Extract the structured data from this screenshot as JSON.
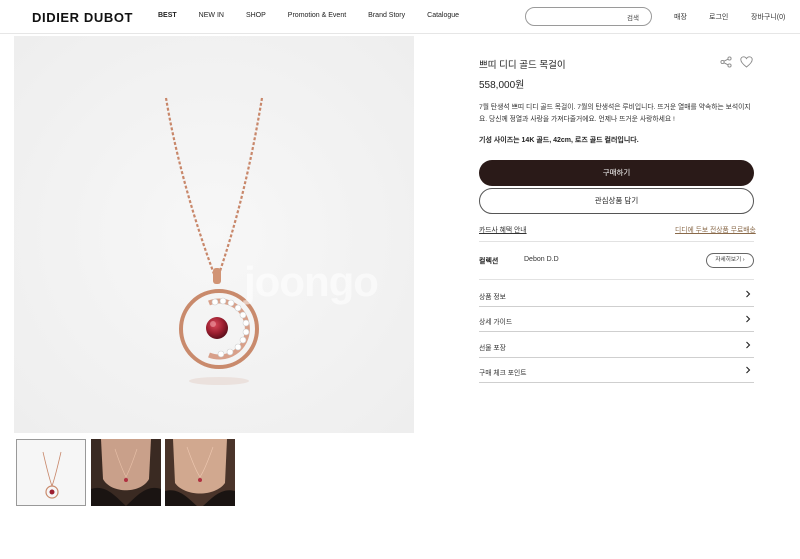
{
  "header": {
    "logo": "DIDIER DUBOT",
    "nav": [
      "BEST",
      "NEW IN",
      "SHOP",
      "Promotion & Event",
      "Brand Story",
      "Catalogue"
    ],
    "search_button": "검색",
    "store": "매장",
    "login": "로그인",
    "cart": "장바구니(0)"
  },
  "watermark": "joongo",
  "product": {
    "title": "쁘띠 디디 골드 목걸이",
    "price": "558,000원",
    "description": "7월 탄생석 쁘띠 디디 골드 목걸이. 7월의 탄생석은 루비입니다. 뜨거운 열매를 약속하는 보석이지요. 당신께 정열과 사랑을 가져다줄거에요. 언제나 뜨거운 사랑하세요 !",
    "spec": "기성 사이즈는 14K 골드, 42cm, 로즈 골드 컬러입니다.",
    "buy_label": "구매하기",
    "wish_label": "관심상품 담기",
    "card_benefit": "카드사 혜택 안내",
    "shipping": "디디에 두보 전상품 무료배송",
    "collection_label": "컬렉션",
    "collection_value": "Debon D.D",
    "detail_button": "자세히보기"
  },
  "accordion": [
    {
      "label": "상품 정보"
    },
    {
      "label": "상세 가이드"
    },
    {
      "label": "선물 포장"
    },
    {
      "label": "구매 체크 포인트"
    }
  ],
  "icons": {
    "share": "share-icon",
    "wishlist": "heart-icon",
    "chevron": "chevron-right-icon"
  },
  "colors": {
    "buy_button": "#2a1a18",
    "shipping_link": "#8a6a4a",
    "rose_gold": "#c8876a",
    "ruby": "#9c1f30"
  }
}
